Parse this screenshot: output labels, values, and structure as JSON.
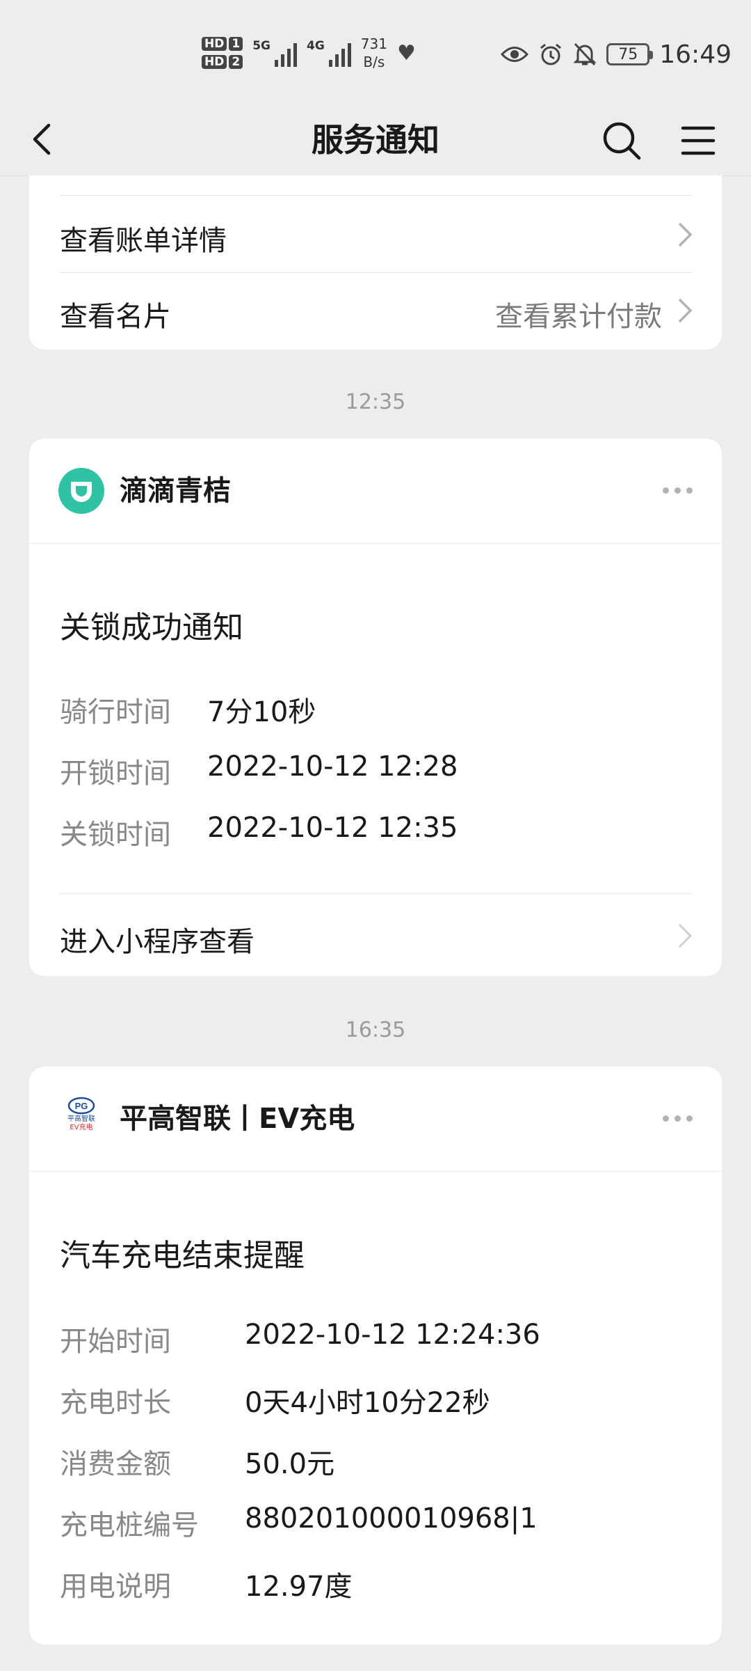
{
  "status_bar": {
    "hd1": "HD",
    "hd1_num": "1",
    "hd2": "HD",
    "hd2_num": "2",
    "net1": "5G",
    "net2": "4G",
    "rate_value": "731",
    "rate_unit": "B/s",
    "battery": "75",
    "time": "16:49"
  },
  "navbar": {
    "title": "服务通知"
  },
  "card_top": {
    "row1_label": "查看账单详情",
    "row2_label": "查看名片",
    "row2_value": "查看累计付款"
  },
  "separator_1": "12:35",
  "card_didi": {
    "app_name": "滴滴青桔",
    "logo_color": "#2fc3a3",
    "title": "关锁成功通知",
    "fields": [
      {
        "key": "骑行时间",
        "value": "7分10秒"
      },
      {
        "key": "开锁时间",
        "value": "2022-10-12 12:28"
      },
      {
        "key": "关锁时间",
        "value": "2022-10-12 12:35"
      }
    ],
    "link": "进入小程序查看"
  },
  "separator_2": "16:35",
  "card_ev": {
    "app_name": "平高智联丨EV充电",
    "logo_text_1": "平高智联",
    "logo_text_2": "EV充电",
    "title": "汽车充电结束提醒",
    "fields": [
      {
        "key": "开始时间",
        "value": "2022-10-12 12:24:36"
      },
      {
        "key": "充电时长",
        "value": "0天4小时10分22秒"
      },
      {
        "key": "消费金额",
        "value": "50.0元"
      },
      {
        "key": "充电桩编号",
        "value": "880201000010968|1"
      },
      {
        "key": "用电说明",
        "value": "12.97度"
      }
    ]
  }
}
